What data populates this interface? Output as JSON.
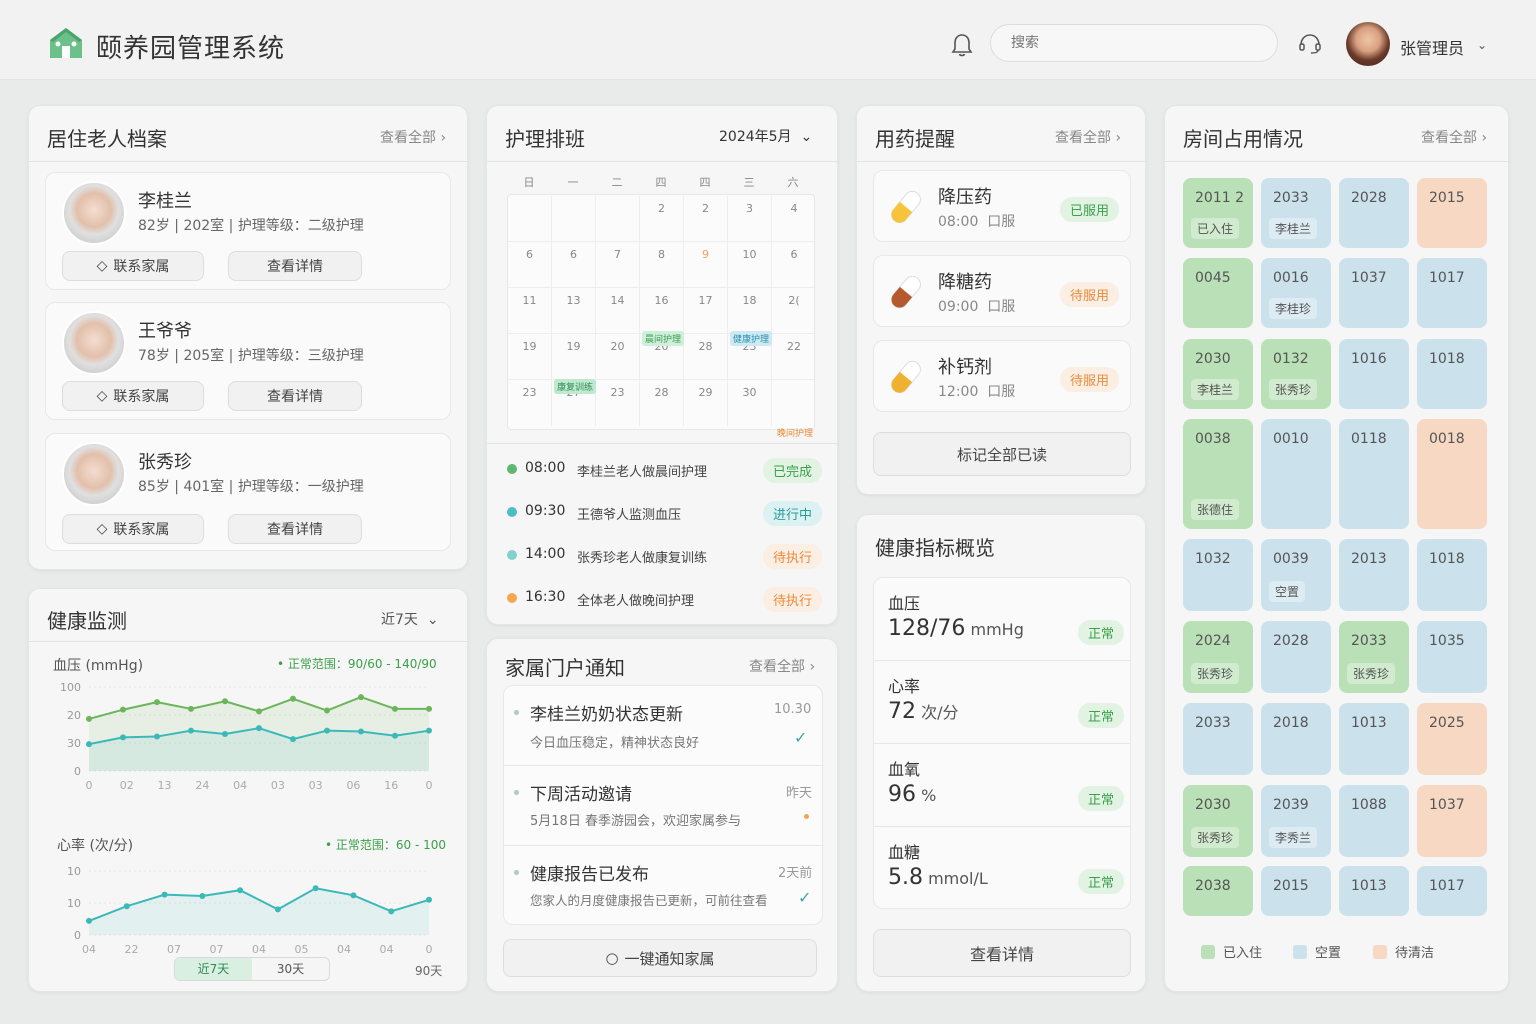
{
  "header": {
    "title": "颐养园管理系统",
    "search_placeholder": "搜索",
    "user_name": "张管理员"
  },
  "residents": {
    "title": "居住老人档案",
    "view_all": "查看全部",
    "items": [
      {
        "name": "李桂兰",
        "age": "82岁",
        "room": "202室",
        "care": "护理等级：二级护理",
        "contact": "联系家属",
        "detail": "查看详情"
      },
      {
        "name": "王爷爷",
        "age": "78岁",
        "room": "205室",
        "care": "护理等级：三级护理",
        "contact": "联系家属",
        "detail": "查看详情"
      },
      {
        "name": "张秀珍",
        "age": "85岁",
        "room": "401室",
        "care": "护理等级：一级护理",
        "contact": "联系家属",
        "detail": "查看详情"
      }
    ]
  },
  "schedule": {
    "title": "护理排班",
    "month": "2024年5月",
    "weekdays": [
      "日",
      "一",
      "二",
      "四",
      "四",
      "三",
      "六"
    ],
    "rows": [
      [
        "",
        "",
        "",
        "2",
        "2",
        "3",
        "4"
      ],
      [
        "6",
        "6",
        "7",
        "8",
        "9",
        "10",
        "6"
      ],
      [
        "11",
        "13",
        "14",
        "16",
        "17",
        "18",
        "2("
      ],
      [
        "19",
        "19",
        "20",
        "20",
        "28",
        "23",
        "22"
      ],
      [
        "23",
        "27",
        "23",
        "28",
        "29",
        "30",
        ""
      ]
    ],
    "tags": {
      "t1": "晨间护理",
      "t2": "健康护理",
      "t3": "康复训练",
      "t4": "晚间护理"
    },
    "tasks": [
      {
        "time": "08:00",
        "text": "李桂兰老人做晨间护理",
        "status": "已完成",
        "color": "#5cb870"
      },
      {
        "time": "09:30",
        "text": "王德爷人监测血压",
        "status": "进行中",
        "color": "#4cbcc6"
      },
      {
        "time": "14:00",
        "text": "张秀珍老人做康复训练",
        "status": "待执行",
        "color": "#7fd3c8"
      },
      {
        "time": "16:30",
        "text": "全体老人做晚间护理",
        "status": "待执行",
        "color": "#f2a850"
      }
    ]
  },
  "meds": {
    "title": "用药提醒",
    "view_all": "查看全部",
    "items": [
      {
        "name": "降压药",
        "time": "08:00",
        "route": "口服",
        "status": "已服用"
      },
      {
        "name": "降糖药",
        "time": "09:00",
        "route": "口服",
        "status": "待服用"
      },
      {
        "name": "补钙剂",
        "time": "12:00",
        "route": "口服",
        "status": "待服用"
      }
    ],
    "mark_all": "标记全部已读"
  },
  "rooms": {
    "title": "房间占用情况",
    "view_all": "查看全部",
    "legend": {
      "occupied": "已入住",
      "empty": "空置",
      "cleaning": "待清洁"
    },
    "cells": [
      {
        "num": "2011 2",
        "name": "已入住",
        "s": "occ"
      },
      {
        "num": "2033",
        "name": "李桂兰",
        "s": "empty"
      },
      {
        "num": "2028",
        "name": "",
        "s": "empty"
      },
      {
        "num": "2015",
        "name": "",
        "s": "clean"
      },
      {
        "num": "0045",
        "name": "",
        "s": "occ"
      },
      {
        "num": "0016",
        "name": "李桂珍",
        "s": "empty"
      },
      {
        "num": "1037",
        "name": "",
        "s": "empty"
      },
      {
        "num": "1017",
        "name": "",
        "s": "empty"
      },
      {
        "num": "2030",
        "name": "李桂兰",
        "s": "occ"
      },
      {
        "num": "0132",
        "name": "张秀珍",
        "s": "occ"
      },
      {
        "num": "1016",
        "name": "",
        "s": "empty"
      },
      {
        "num": "1018",
        "name": "",
        "s": "empty"
      },
      {
        "num": "0038",
        "name": "张德住",
        "s": "occ"
      },
      {
        "num": "0010",
        "name": "",
        "s": "empty"
      },
      {
        "num": "0118",
        "name": "",
        "s": "empty"
      },
      {
        "num": "0018",
        "name": "",
        "s": "clean"
      },
      {
        "num": "1032",
        "name": "",
        "s": "empty"
      },
      {
        "num": "0039",
        "name": "空置",
        "s": "empty"
      },
      {
        "num": "2013",
        "name": "",
        "s": "empty"
      },
      {
        "num": "1018",
        "name": "",
        "s": "empty"
      },
      {
        "num": "2024",
        "name": "张秀珍",
        "s": "occ"
      },
      {
        "num": "2028",
        "name": "",
        "s": "empty"
      },
      {
        "num": "2033",
        "name": "张秀珍",
        "s": "occ"
      },
      {
        "num": "1035",
        "name": "",
        "s": "empty"
      },
      {
        "num": "2033",
        "name": "",
        "s": "empty"
      },
      {
        "num": "2018",
        "name": "",
        "s": "empty"
      },
      {
        "num": "1013",
        "name": "",
        "s": "empty"
      },
      {
        "num": "2025",
        "name": "",
        "s": "clean"
      },
      {
        "num": "2030",
        "name": "张秀珍",
        "s": "occ"
      },
      {
        "num": "2039",
        "name": "李秀兰",
        "s": "empty"
      },
      {
        "num": "1088",
        "name": "",
        "s": "empty"
      },
      {
        "num": "1037",
        "name": "",
        "s": "clean"
      },
      {
        "num": "2038",
        "name": "",
        "s": "occ"
      },
      {
        "num": "2015",
        "name": "",
        "s": "empty"
      },
      {
        "num": "1013",
        "name": "",
        "s": "empty"
      },
      {
        "num": "1017",
        "name": "",
        "s": "empty"
      }
    ]
  },
  "health": {
    "title": "健康监测",
    "range": "近7天",
    "bp_label": "血压 (mmHg)",
    "bp_range": "• 正常范围：90/60 - 140/90",
    "hr_label": "心率 (次/分)",
    "hr_range": "• 正常范围：60 - 100",
    "btn7": "近7天",
    "btn30": "30天",
    "btn90": "90天"
  },
  "chart_data": [
    {
      "type": "line",
      "title": "血压 (mmHg)",
      "x": [
        "0",
        "02",
        "13",
        "24",
        "04",
        "03",
        "03",
        "06",
        "16",
        "0"
      ],
      "y_ticks": [
        "100",
        "20",
        "30",
        "0"
      ],
      "series": [
        {
          "values": [
            62,
            73,
            82,
            74,
            83,
            71,
            86,
            72,
            88,
            74,
            74
          ]
        },
        {
          "values": [
            32,
            40,
            41,
            48,
            44,
            51,
            38,
            48,
            47,
            42,
            48
          ]
        }
      ],
      "colors": [
        "#6bb55a",
        "#3db8b8"
      ]
    },
    {
      "type": "line",
      "title": "心率 (次/分)",
      "x": [
        "04",
        "22",
        "07",
        "07",
        "04",
        "05",
        "04",
        "04",
        "0"
      ],
      "y_ticks": [
        "10",
        "10",
        "0"
      ],
      "series": [
        {
          "values": [
            22,
            45,
            63,
            61,
            70,
            40,
            73,
            62,
            37,
            55
          ]
        }
      ],
      "colors": [
        "#3db8b8"
      ]
    }
  ],
  "family": {
    "title": "家属门户通知",
    "view_all": "查看全部",
    "items": [
      {
        "title": "李桂兰奶奶状态更新",
        "sub": "今日血压稳定，精神状态良好",
        "time": "10.30"
      },
      {
        "title": "下周活动邀请",
        "sub": "5月18日 春季游园会，欢迎家属参与",
        "time": "昨天"
      },
      {
        "title": "健康报告已发布",
        "sub": "您家人的月度健康报告已更新，可前往查看",
        "time": "2天前"
      }
    ],
    "notify_all": "一键通知家属"
  },
  "metrics": {
    "title": "健康指标概览",
    "items": [
      {
        "label": "血压",
        "value": "128/76",
        "unit": "mmHg",
        "status": "正常"
      },
      {
        "label": "心率",
        "value": "72",
        "unit": "次/分",
        "status": "正常"
      },
      {
        "label": "血氧",
        "value": "96",
        "unit": "%",
        "status": "正常"
      },
      {
        "label": "血糖",
        "value": "5.8",
        "unit": "mmol/L",
        "status": "正常"
      }
    ],
    "view_details": "查看详情"
  }
}
